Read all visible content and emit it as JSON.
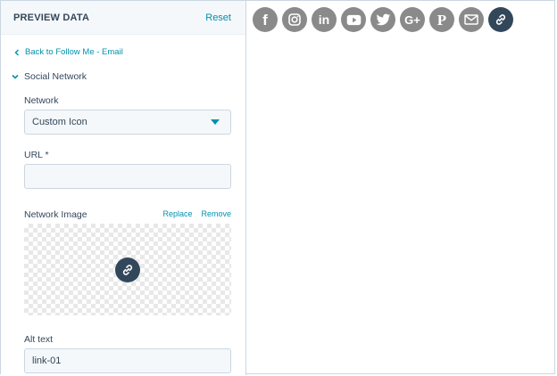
{
  "panel": {
    "title": "PREVIEW DATA",
    "reset_label": "Reset",
    "back_label": "Back to Follow Me - Email",
    "section_label": "Social Network"
  },
  "network": {
    "label": "Network",
    "value": "Custom Icon"
  },
  "url": {
    "label": "URL *",
    "value": "",
    "placeholder": ""
  },
  "network_image": {
    "label": "Network Image",
    "replace_label": "Replace",
    "remove_label": "Remove",
    "preview_icon": "link-icon"
  },
  "alt_text": {
    "label": "Alt text",
    "value": "link-01"
  },
  "social_icons": [
    {
      "name": "facebook-icon",
      "glyph": "f"
    },
    {
      "name": "instagram-icon",
      "glyph": ""
    },
    {
      "name": "linkedin-icon",
      "glyph": "in"
    },
    {
      "name": "youtube-icon",
      "glyph": ""
    },
    {
      "name": "twitter-icon",
      "glyph": ""
    },
    {
      "name": "google-plus-icon",
      "glyph": "G+"
    },
    {
      "name": "pinterest-icon",
      "glyph": "P"
    },
    {
      "name": "email-icon",
      "glyph": ""
    },
    {
      "name": "link-icon",
      "glyph": ""
    }
  ],
  "colors": {
    "accent": "#0091ae",
    "text": "#33475b",
    "icon_gray": "#8a8a8a",
    "icon_active": "#33475b",
    "field_bg": "#f5f8fa",
    "border": "#cbd6e2"
  }
}
